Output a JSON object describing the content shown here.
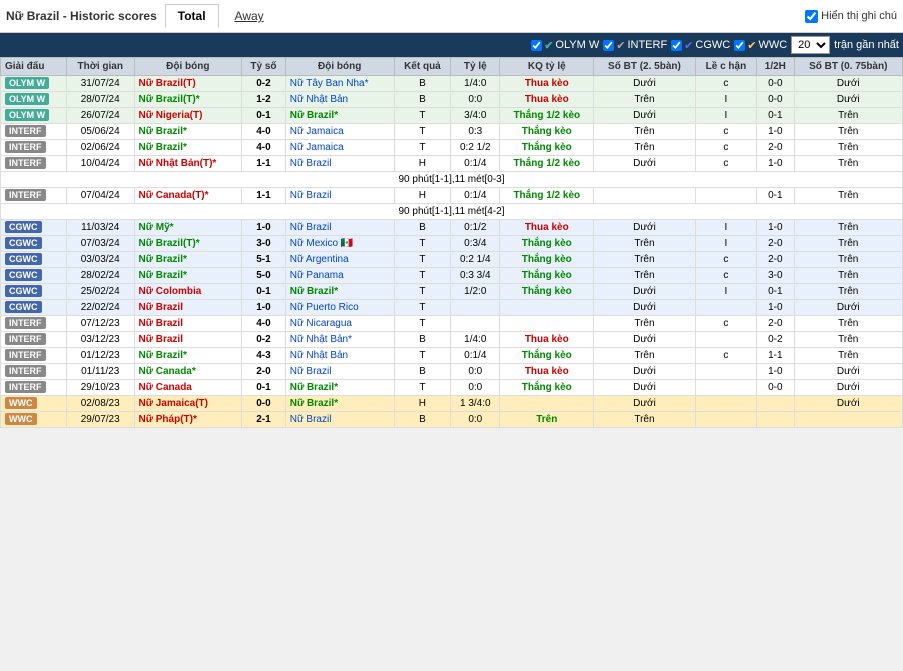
{
  "header": {
    "title": "Nữ Brazil - Historic scores",
    "tabs": [
      {
        "label": "Total",
        "active": true
      },
      {
        "label": "Away",
        "active": false
      }
    ],
    "checkbox_label": "Hiển thị ghi chú"
  },
  "filter": {
    "options": [
      {
        "label": "OLYM W",
        "checked": true
      },
      {
        "label": "INTERF",
        "checked": true
      },
      {
        "label": "CGWC",
        "checked": true
      },
      {
        "label": "WWC",
        "checked": true
      }
    ],
    "select_value": "20",
    "select_label": "trận gần nhất"
  },
  "table": {
    "headers": [
      "Giải đấu",
      "Thời gian",
      "Đội bóng",
      "Tỷ số",
      "Đội bóng",
      "Kết quả",
      "Tỷ lệ",
      "KQ tỷ lệ",
      "Số BT (2.5bàn)",
      "Lề c hận",
      "1/2H",
      "Số BT (0.75bàn)"
    ],
    "rows": [
      {
        "type": "OLYM W",
        "date": "31/07/24",
        "home": "Nữ Brazil(T)",
        "home_color": "red",
        "score": "0-2",
        "away": "Nữ Tây Ban Nha*",
        "away_color": "blue",
        "result": "B",
        "ratio": "1/4:0",
        "kq": "Thua kèo",
        "kq_color": "lose",
        "sobt": "Dưới",
        "le": "c",
        "half": "0-0",
        "sobt2": "Dưới"
      },
      {
        "type": "OLYM W",
        "date": "28/07/24",
        "home": "Nữ Brazil(T)*",
        "home_color": "green",
        "score": "1-2",
        "away": "Nữ Nhật Bản",
        "away_color": "blue",
        "result": "B",
        "ratio": "0:0",
        "kq": "Thua kèo",
        "kq_color": "lose",
        "sobt": "Trên",
        "le": "I",
        "half": "0-0",
        "sobt2": "Dưới"
      },
      {
        "type": "OLYM W",
        "date": "26/07/24",
        "home": "Nữ Nigeria(T)",
        "home_color": "red",
        "score": "0-1",
        "away": "Nữ Brazil*",
        "away_color": "green",
        "result": "T",
        "ratio": "3/4:0",
        "kq": "Thắng 1/2 kèo",
        "kq_color": "win",
        "sobt": "Dưới",
        "le": "I",
        "half": "0-1",
        "sobt2": "Trên"
      },
      {
        "type": "INTERF",
        "date": "05/06/24",
        "home": "Nữ Brazil*",
        "home_color": "green",
        "score": "4-0",
        "away": "Nữ Jamaica",
        "away_color": "blue",
        "result": "T",
        "ratio": "0:3",
        "kq": "Thắng kèo",
        "kq_color": "win",
        "sobt": "Trên",
        "le": "c",
        "half": "1-0",
        "sobt2": "Trên"
      },
      {
        "type": "INTERF",
        "date": "02/06/24",
        "home": "Nữ Brazil*",
        "home_color": "green",
        "score": "4-0",
        "away": "Nữ Jamaica",
        "away_color": "blue",
        "result": "T",
        "ratio": "0:2 1/2",
        "kq": "Thắng kèo",
        "kq_color": "win",
        "sobt": "Trên",
        "le": "c",
        "half": "2-0",
        "sobt2": "Trên"
      },
      {
        "type": "INTERF",
        "date": "10/04/24",
        "home": "Nữ Nhật Bản(T)*",
        "home_color": "red",
        "score": "1-1",
        "away": "Nữ Brazil",
        "away_color": "blue",
        "result": "H",
        "ratio": "0:1/4",
        "kq": "Thắng 1/2 kèo",
        "kq_color": "win",
        "sobt": "Dưới",
        "le": "c",
        "half": "1-0",
        "sobt2": "Trên"
      },
      {
        "type": "separator",
        "text": "90 phút[1-1],11 mét[0-3]"
      },
      {
        "type": "INTERF",
        "date": "07/04/24",
        "home": "Nữ Canada(T)*",
        "home_color": "red",
        "score": "1-1",
        "away": "Nữ Brazil",
        "away_color": "blue",
        "result": "H",
        "ratio": "0:1/4",
        "kq": "Thắng 1/2 kèo",
        "kq_color": "win",
        "sobt": "",
        "le": "",
        "half": "0-1",
        "sobt2": "Trên"
      },
      {
        "type": "separator",
        "text": "90 phút[1-1],11 mét[4-2]"
      },
      {
        "type": "CGWC",
        "date": "11/03/24",
        "home": "Nữ Mỹ*",
        "home_color": "green",
        "score": "1-0",
        "away": "Nữ Brazil",
        "away_color": "blue",
        "result": "B",
        "ratio": "0:1/2",
        "kq": "Thua kèo",
        "kq_color": "lose",
        "sobt": "Dưới",
        "le": "I",
        "half": "1-0",
        "sobt2": "Trên"
      },
      {
        "type": "CGWC",
        "date": "07/03/24",
        "home": "Nữ Brazil(T)*",
        "home_color": "green",
        "score": "3-0",
        "away": "Nữ Mexico 🇲🇽",
        "away_color": "blue",
        "result": "T",
        "ratio": "0:3/4",
        "kq": "Thắng kèo",
        "kq_color": "win",
        "sobt": "Trên",
        "le": "I",
        "half": "2-0",
        "sobt2": "Trên"
      },
      {
        "type": "CGWC",
        "date": "03/03/24",
        "home": "Nữ Brazil*",
        "home_color": "green",
        "score": "5-1",
        "away": "Nữ Argentina",
        "away_color": "blue",
        "result": "T",
        "ratio": "0:2 1/4",
        "kq": "Thắng kèo",
        "kq_color": "win",
        "sobt": "Trên",
        "le": "c",
        "half": "2-0",
        "sobt2": "Trên"
      },
      {
        "type": "CGWC",
        "date": "28/02/24",
        "home": "Nữ Brazil*",
        "home_color": "green",
        "score": "5-0",
        "away": "Nữ Panama",
        "away_color": "blue",
        "result": "T",
        "ratio": "0:3 3/4",
        "kq": "Thắng kèo",
        "kq_color": "win",
        "sobt": "Trên",
        "le": "c",
        "half": "3-0",
        "sobt2": "Trên"
      },
      {
        "type": "CGWC",
        "date": "25/02/24",
        "home": "Nữ Colombia",
        "home_color": "red",
        "score": "0-1",
        "away": "Nữ Brazil*",
        "away_color": "green",
        "result": "T",
        "ratio": "1/2:0",
        "kq": "Thắng kèo",
        "kq_color": "win",
        "sobt": "Dưới",
        "le": "I",
        "half": "0-1",
        "sobt2": "Trên"
      },
      {
        "type": "CGWC",
        "date": "22/02/24",
        "home": "Nữ Brazil",
        "home_color": "red",
        "score": "1-0",
        "away": "Nữ Puerto Rico",
        "away_color": "blue",
        "result": "T",
        "ratio": "",
        "kq": "",
        "kq_color": "",
        "sobt": "Dưới",
        "le": "",
        "half": "1-0",
        "sobt2": "Dưới"
      },
      {
        "type": "INTERF",
        "date": "07/12/23",
        "home": "Nữ Brazil",
        "home_color": "red",
        "score": "4-0",
        "away": "Nữ Nicaragua",
        "away_color": "blue",
        "result": "T",
        "ratio": "",
        "kq": "",
        "kq_color": "",
        "sobt": "Trên",
        "le": "c",
        "half": "2-0",
        "sobt2": "Trên"
      },
      {
        "type": "INTERF",
        "date": "03/12/23",
        "home": "Nữ Brazil",
        "home_color": "red",
        "score": "0-2",
        "away": "Nữ Nhật Bản*",
        "away_color": "blue",
        "result": "B",
        "ratio": "1/4:0",
        "kq": "Thua kèo",
        "kq_color": "lose",
        "sobt": "Dưới",
        "le": "",
        "half": "0-2",
        "sobt2": "Trên"
      },
      {
        "type": "INTERF",
        "date": "01/12/23",
        "home": "Nữ Brazil*",
        "home_color": "green",
        "score": "4-3",
        "away": "Nữ Nhật Bản",
        "away_color": "blue",
        "result": "T",
        "ratio": "0:1/4",
        "kq": "Thắng kèo",
        "kq_color": "win",
        "sobt": "Trên",
        "le": "c",
        "half": "1-1",
        "sobt2": "Trên"
      },
      {
        "type": "INTERF",
        "date": "01/11/23",
        "home": "Nữ Canada*",
        "home_color": "green",
        "score": "2-0",
        "away": "Nữ Brazil",
        "away_color": "blue",
        "result": "B",
        "ratio": "0:0",
        "kq": "Thua kèo",
        "kq_color": "lose",
        "sobt": "Dưới",
        "le": "",
        "half": "1-0",
        "sobt2": "Dưới"
      },
      {
        "type": "INTERF",
        "date": "29/10/23",
        "home": "Nữ Canada",
        "home_color": "red",
        "score": "0-1",
        "away": "Nữ Brazil*",
        "away_color": "green",
        "result": "T",
        "ratio": "0:0",
        "kq": "Thắng kèo",
        "kq_color": "win",
        "sobt": "Dưới",
        "le": "",
        "half": "0-0",
        "sobt2": "Dưới"
      },
      {
        "type": "WWC",
        "date": "02/08/23",
        "home": "Nữ Jamaica(T)",
        "home_color": "red",
        "score": "0-0",
        "away": "Nữ Brazil*",
        "away_color": "green",
        "result": "H",
        "ratio": "1 3/4:0",
        "kq": "",
        "kq_color": "",
        "sobt": "Dưới",
        "le": "",
        "half": "",
        "sobt2": "Dưới"
      },
      {
        "type": "WWC",
        "date": "29/07/23",
        "home": "Nữ Pháp(T)*",
        "home_color": "red",
        "score": "2-1",
        "away": "Nữ Brazil",
        "away_color": "blue",
        "result": "B",
        "ratio": "0:0",
        "kq": "Trên",
        "kq_color": "win",
        "sobt": "Trên",
        "le": "",
        "half": "",
        "sobt2": ""
      }
    ]
  }
}
